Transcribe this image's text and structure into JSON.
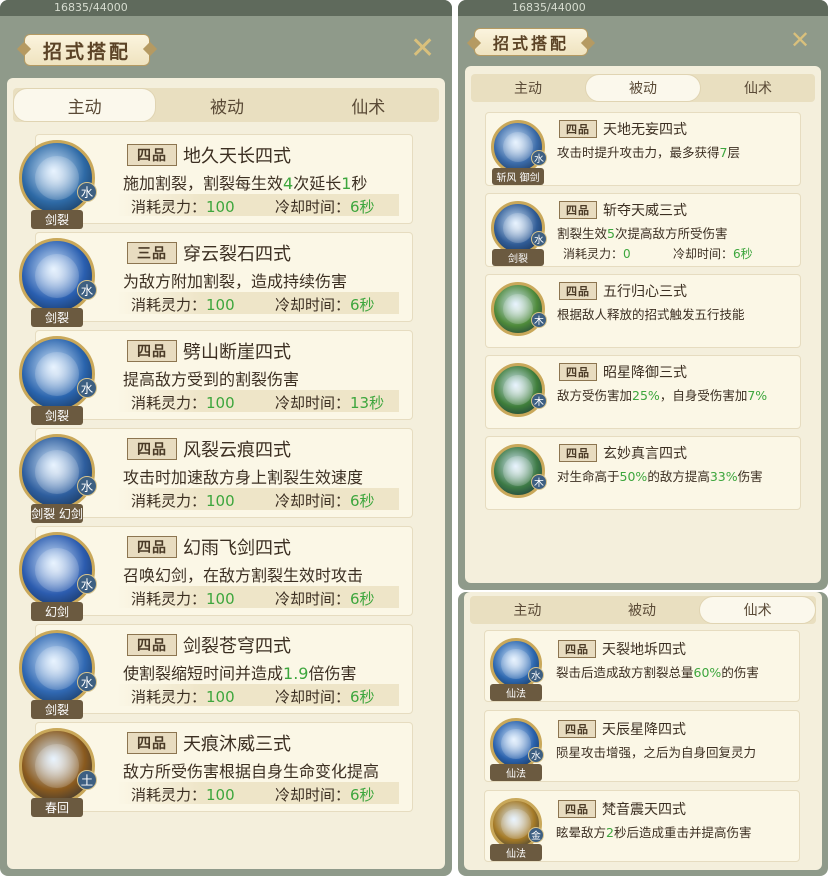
{
  "top_text": "16835/44000",
  "main": {
    "title": "招式搭配",
    "tabs": [
      {
        "label": "主动",
        "active": true
      },
      {
        "label": "被动",
        "active": false
      },
      {
        "label": "仙术",
        "active": false
      }
    ],
    "cost_label": "消耗灵力：",
    "cd_label": "冷却时间：",
    "skills": [
      {
        "grade": "四品",
        "name": "地久天长四式",
        "desc_pre": "施加割裂，割裂每生效",
        "hl1": "4",
        "desc_mid": "次延长",
        "hl2": "1",
        "desc_post": "秒",
        "cost": "100",
        "cd": "6秒",
        "tag": "剑裂",
        "element": "水",
        "color": "#2e6aa6"
      },
      {
        "grade": "三品",
        "name": "穿云裂石四式",
        "desc_pre": "为敌方附加割裂，造成持续伤害",
        "hl1": "",
        "desc_mid": "",
        "hl2": "",
        "desc_post": "",
        "cost": "100",
        "cd": "6秒",
        "tag": "剑裂",
        "element": "水",
        "color": "#2a5fb0"
      },
      {
        "grade": "四品",
        "name": "劈山断崖四式",
        "desc_pre": "提高敌方受到的割裂伤害",
        "hl1": "",
        "desc_mid": "",
        "hl2": "",
        "desc_post": "",
        "cost": "100",
        "cd": "13秒",
        "tag": "剑裂",
        "element": "水",
        "color": "#2a64ad"
      },
      {
        "grade": "四品",
        "name": "风裂云痕四式",
        "desc_pre": "攻击时加速敌方身上割裂生效速度",
        "hl1": "",
        "desc_mid": "",
        "hl2": "",
        "desc_post": "",
        "cost": "100",
        "cd": "6秒",
        "tag": "剑裂 幻剑",
        "element": "水",
        "color": "#2e5e9e"
      },
      {
        "grade": "四品",
        "name": "幻雨飞剑四式",
        "desc_pre": "召唤幻剑，在敌方割裂生效时攻击",
        "hl1": "",
        "desc_mid": "",
        "hl2": "",
        "desc_post": "",
        "cost": "100",
        "cd": "6秒",
        "tag": "幻剑",
        "element": "水",
        "color": "#2c5caf"
      },
      {
        "grade": "四品",
        "name": "剑裂苍穹四式",
        "desc_pre": "使割裂缩短时间并造成",
        "hl1": "1.9",
        "desc_mid": "倍伤害",
        "hl2": "",
        "desc_post": "",
        "cost": "100",
        "cd": "6秒",
        "tag": "剑裂",
        "element": "水",
        "color": "#3068b2"
      },
      {
        "grade": "四品",
        "name": "天痕沐威三式",
        "desc_pre": "敌方所受伤害根据自身生命变化提高",
        "hl1": "",
        "desc_mid": "",
        "hl2": "",
        "desc_post": "",
        "cost": "100",
        "cd": "6秒",
        "tag": "春回",
        "element": "土",
        "color": "#8a5a1e"
      }
    ]
  },
  "passive": {
    "title": "招式搭配",
    "tabs": [
      {
        "label": "主动",
        "active": false
      },
      {
        "label": "被动",
        "active": true
      },
      {
        "label": "仙术",
        "active": false
      }
    ],
    "cost_label": "消耗灵力：",
    "cd_label": "冷却时间：",
    "skills": [
      {
        "grade": "四品",
        "name": "天地无妄四式",
        "desc_pre": "攻击时提升攻击力，最多获得",
        "hl1": "7",
        "desc_post": "层",
        "tag": "斩风 御剑",
        "element": "水",
        "color": "#3a6aa8",
        "has_stats": false
      },
      {
        "grade": "四品",
        "name": "斩夺天威三式",
        "desc_pre": "割裂生效",
        "hl1": "5",
        "desc_post": "次提高敌方所受伤害",
        "tag": "剑裂",
        "element": "水",
        "color": "#2f5b95",
        "has_stats": true,
        "cost": "0",
        "cd": "6秒"
      },
      {
        "grade": "四品",
        "name": "五行归心三式",
        "desc_pre": "根据敌人释放的招式触发五行技能",
        "hl1": "",
        "desc_post": "",
        "tag": "",
        "element": "木",
        "color": "#4e8a3a",
        "has_stats": false
      },
      {
        "grade": "四品",
        "name": "昭星降御三式",
        "desc_pre": "敌方受伤害加",
        "hl1": "25%",
        "desc_post": "，自身受伤害加",
        "hl2": "7%",
        "tag": "",
        "element": "木",
        "color": "#3f7e3a",
        "has_stats": false
      },
      {
        "grade": "四品",
        "name": "玄妙真言四式",
        "desc_pre": "对生命高于",
        "hl1": "50%",
        "desc_post": "的敌方提高",
        "hl2": "33%",
        "desc_end": "伤害",
        "tag": "",
        "element": "木",
        "color": "#3d7a45",
        "has_stats": false
      }
    ]
  },
  "immortal": {
    "tabs": [
      {
        "label": "主动",
        "active": false
      },
      {
        "label": "被动",
        "active": false
      },
      {
        "label": "仙术",
        "active": true
      }
    ],
    "skills": [
      {
        "grade": "四品",
        "name": "天裂地坼四式",
        "desc_pre": "裂击后造成敌方割裂总量",
        "hl1": "60%",
        "desc_post": "的伤害",
        "tag": "仙法",
        "element": "水",
        "color": "#2d68b0"
      },
      {
        "grade": "四品",
        "name": "天辰星降四式",
        "desc_pre": "陨星攻击增强，之后为自身回复灵力",
        "hl1": "",
        "desc_post": "",
        "tag": "仙法",
        "element": "水",
        "color": "#2a62ad"
      },
      {
        "grade": "四品",
        "name": "梵音震天四式",
        "desc_pre": "眩晕敌方",
        "hl1": "2",
        "desc_post": "秒后造成重击并提高伤害",
        "tag": "仙法",
        "element": "金",
        "color": "#a57a26"
      }
    ]
  }
}
